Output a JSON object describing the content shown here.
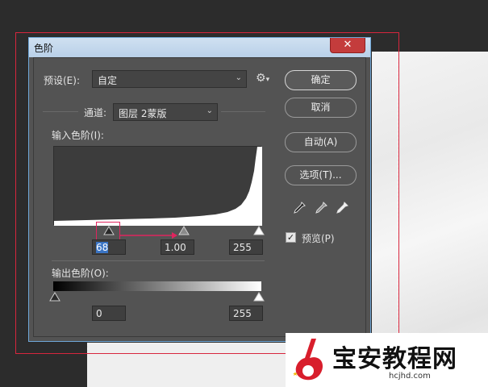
{
  "dialog": {
    "title": "色阶",
    "close_label": "✕"
  },
  "preset": {
    "label": "预设(E):",
    "value": "自定"
  },
  "channel": {
    "label": "通道:",
    "value": "图层 2蒙版"
  },
  "input_levels": {
    "label": "输入色阶(I):",
    "black": "68",
    "gray": "1.00",
    "white": "255"
  },
  "output_levels": {
    "label": "输出色阶(O):",
    "black": "0",
    "white": "255"
  },
  "buttons": {
    "ok": "确定",
    "cancel": "取消",
    "auto": "自动(A)",
    "options": "选项(T)..."
  },
  "preview": {
    "label": "预览(P)",
    "checked": true
  },
  "icons": {
    "gear": "gear-icon",
    "eyedroppers": [
      "black-eyedropper-icon",
      "gray-eyedropper-icon",
      "white-eyedropper-icon"
    ]
  },
  "watermark": {
    "text": "宝安教程网",
    "url": "hcjhd.com"
  },
  "colors": {
    "annotation": "#e0245e",
    "selection": "#3a74c4",
    "close_button": "#c43c3c"
  }
}
